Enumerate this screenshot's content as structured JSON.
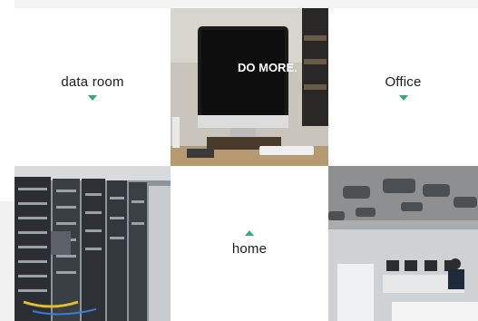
{
  "tiles": {
    "data_room": {
      "label": "data room",
      "arrow": "chevron-down-icon"
    },
    "office": {
      "label": "Office",
      "arrow": "chevron-down-icon"
    },
    "home": {
      "label": "home",
      "arrow": "chevron-up-icon"
    }
  },
  "photos": {
    "workspace_screen_text": "DO MORE."
  },
  "colors": {
    "accent": "#1fb56f",
    "text": "#1b1b1b",
    "background": "#ffffff"
  }
}
